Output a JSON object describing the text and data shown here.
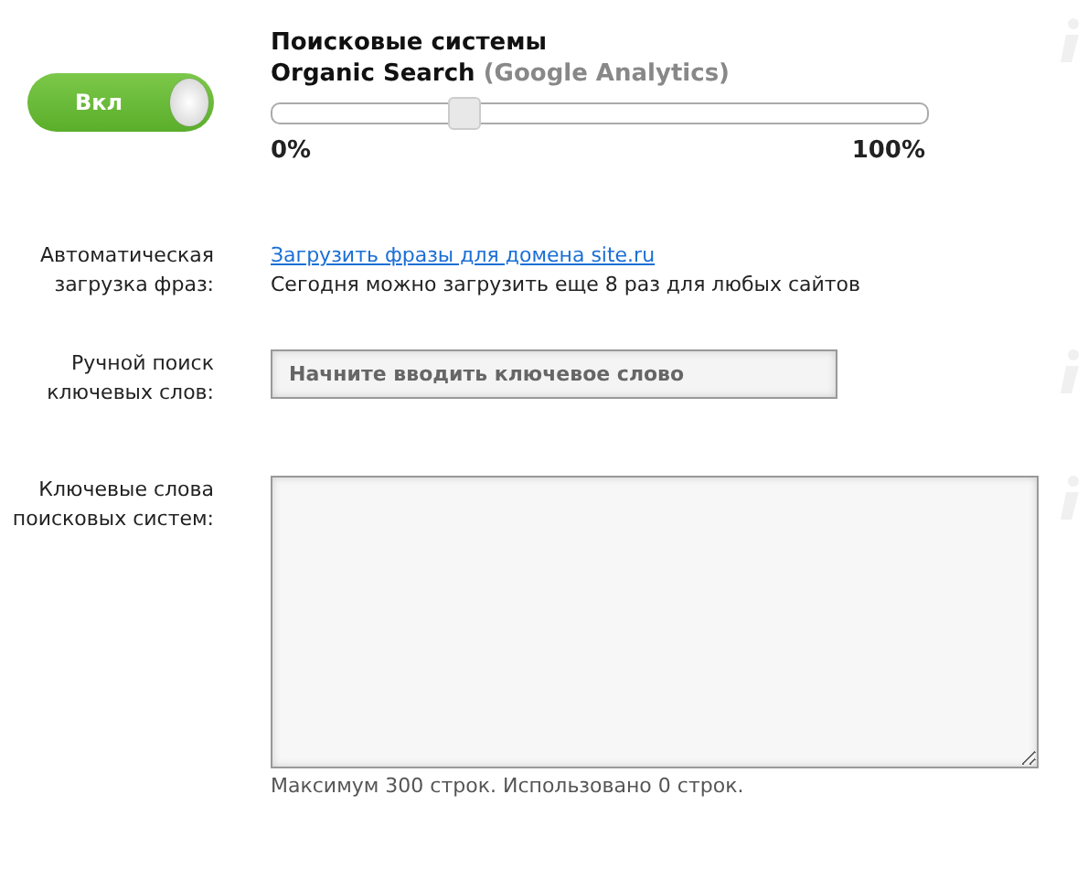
{
  "toggle": {
    "label": "Вкл",
    "on": true
  },
  "header": {
    "title": "Поисковые системы",
    "subtitle": "Organic Search",
    "source": "(Google Analytics)"
  },
  "slider": {
    "level": 0.3,
    "min_label": "0%",
    "max_label": "100%"
  },
  "auto_load": {
    "label": "Автоматическая загрузка фраз:",
    "link": "Загрузить фразы для домена site.ru",
    "note": "Сегодня можно загрузить еще 8 раз для любых сайтов"
  },
  "manual_search": {
    "label": "Ручной поиск ключевых слов:",
    "placeholder": "Начните вводить ключевое слово"
  },
  "keywords": {
    "label": "Ключевые слова поисковых систем:",
    "note": "Максимум 300 строк. Использовано 0 строк."
  }
}
